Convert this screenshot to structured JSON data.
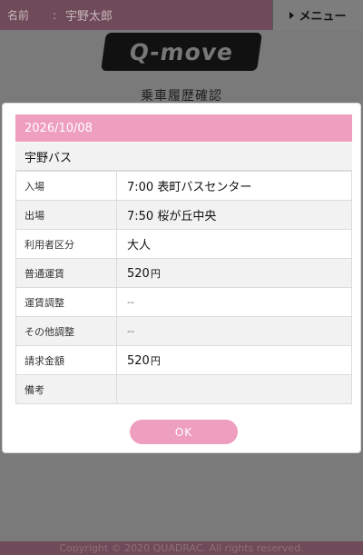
{
  "header": {
    "name_label": "名前",
    "separator": ":",
    "user_name": "宇野太郎",
    "menu_label": "メニュー"
  },
  "logo": {
    "text": "Q-move"
  },
  "page_title": "乗車履歴確認",
  "record": {
    "date": "2026/10/08",
    "operator": "宇野バス",
    "rows": [
      {
        "label": "入場",
        "value": "7:00 表町バスセンター",
        "unit": ""
      },
      {
        "label": "出場",
        "value": "7:50 桜が丘中央",
        "unit": ""
      },
      {
        "label": "利用者区分",
        "value": "大人",
        "unit": ""
      },
      {
        "label": "普通運賃",
        "value": "520",
        "unit": "円"
      },
      {
        "label": "運賃調整",
        "value": "--",
        "unit": ""
      },
      {
        "label": "その他調整",
        "value": "--",
        "unit": ""
      },
      {
        "label": "請求金額",
        "value": "520",
        "unit": "円"
      },
      {
        "label": "備考",
        "value": "",
        "unit": ""
      }
    ]
  },
  "ok_label": "OK",
  "footer": "Copyright © 2020 QUADRAC. All rights reserved.",
  "colors": {
    "accent_pink": "#ee9ebf",
    "header_bg": "#6f4a58",
    "overlay": "#7a7a7a"
  }
}
